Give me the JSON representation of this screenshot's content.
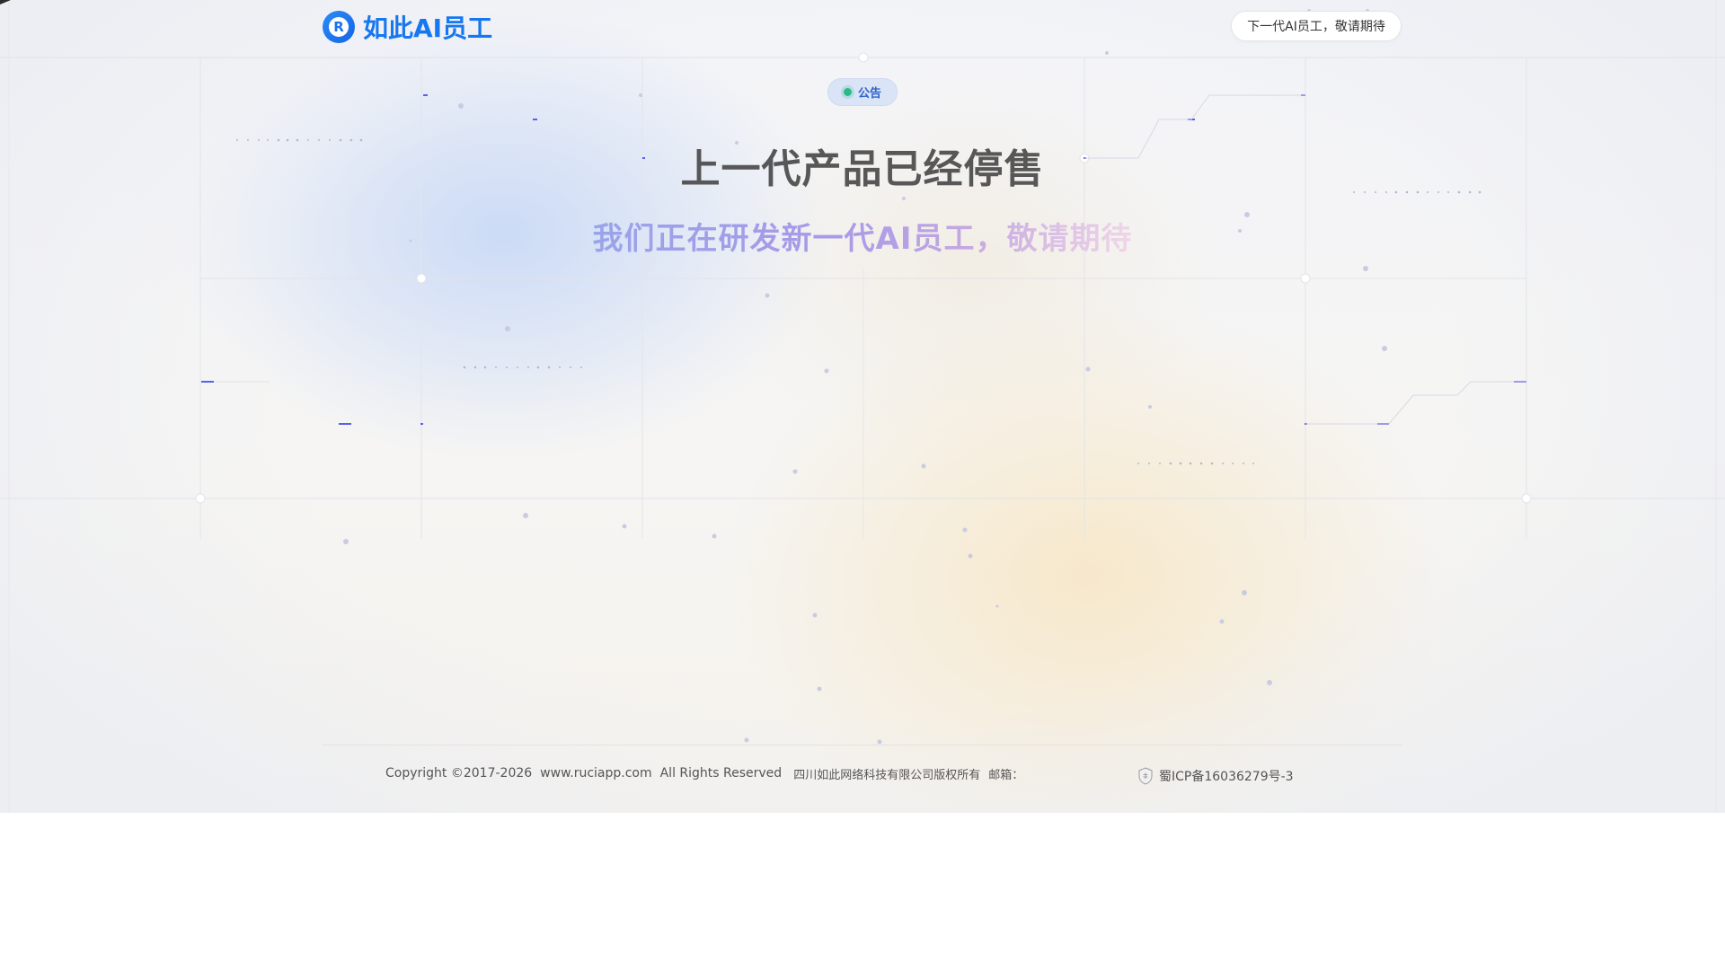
{
  "header": {
    "logo_text": "如此AI员工",
    "logo_letter": "R",
    "cta_label": "下一代AI员工，敬请期待"
  },
  "announcement": {
    "badge_label": "公告",
    "headline": "上一代产品已经停售",
    "subheadline": "我们正在研发新一代AI员工，敬请期待"
  },
  "footer": {
    "copyright": "Copyright ©2017-2026",
    "website": "www.ruciapp.com",
    "rights": "All Rights Reserved",
    "company": "四川如此网络科技有限公司版权所有",
    "email_label": "邮箱：",
    "icp": "蜀ICP备16036279号-3"
  },
  "colors": {
    "brand": "#1677f0",
    "headline": "#575757",
    "badge_text": "#2d62c9",
    "badge_dot": "#2cb98a",
    "accent_line": "#5a5ff0"
  },
  "icons": {
    "logo": "r-logo-icon",
    "status": "green-dot-icon",
    "icp": "shield-icon"
  }
}
